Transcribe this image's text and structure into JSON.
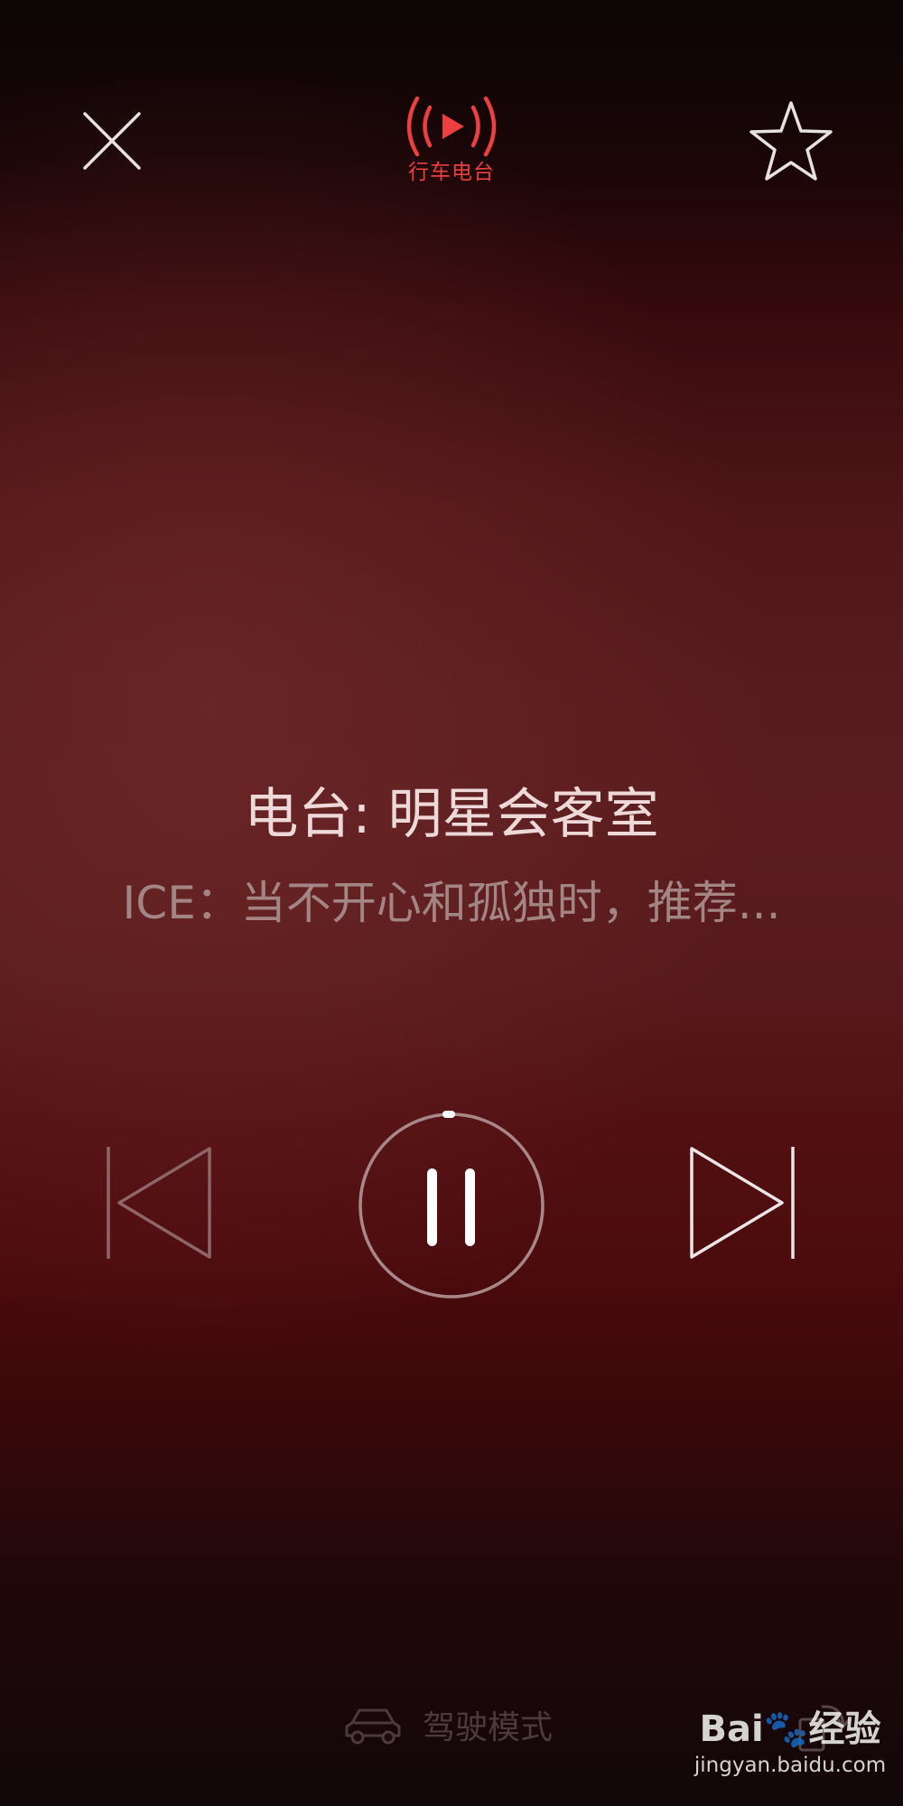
{
  "header": {
    "close_icon": "close-icon",
    "logo_icon": "radio-broadcast-play-icon",
    "logo_label": "行车电台",
    "favorite_icon": "star-outline-icon"
  },
  "now_playing": {
    "station": "电台: 明星会客室",
    "track": "ICE：当不开心和孤独时，推荐..."
  },
  "controls": {
    "previous_icon": "skip-previous-icon",
    "pause_icon": "pause-icon",
    "next_icon": "skip-next-icon"
  },
  "footer": {
    "drive_mode_icon": "car-icon",
    "drive_mode_label": "驾驶模式",
    "rotate_icon": "rotate-screen-icon"
  },
  "watermark": {
    "brand": "Bai🐾经验",
    "url": "jingyan.baidu.com"
  },
  "colors": {
    "accent": "#ec3f3f",
    "title_text": "#eed9d9",
    "subtitle_text": "#a38584"
  }
}
